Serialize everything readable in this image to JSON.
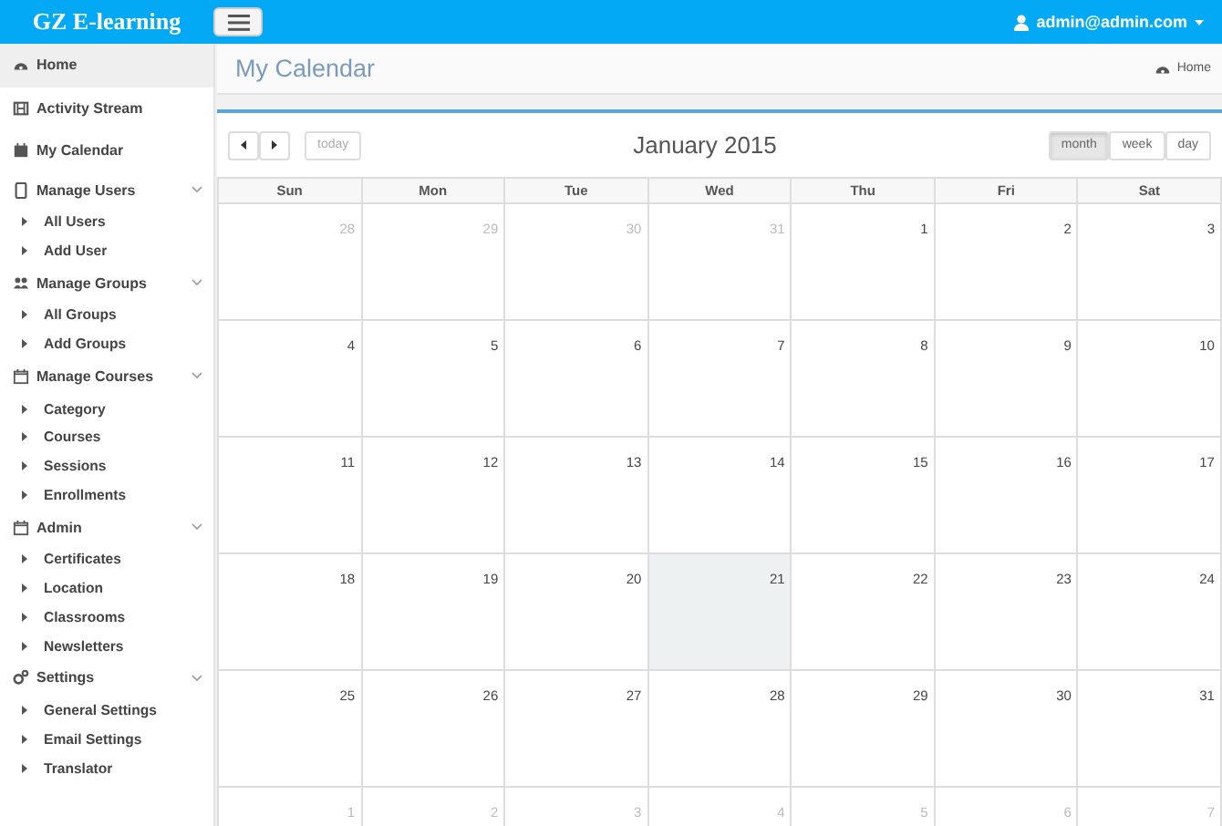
{
  "brand": "GZ E-learning",
  "user": "admin@admin.com",
  "sidebar": [
    {
      "label": "Home",
      "selected": true
    },
    {
      "label": "Activity Stream",
      "selected": false
    },
    {
      "label": "My Calendar",
      "selected": false
    },
    {
      "label": "Manage Users",
      "selected": false,
      "expanded": true,
      "children": [
        {
          "label": "All Users"
        },
        {
          "label": "Add User"
        }
      ]
    },
    {
      "label": "Manage Groups",
      "selected": false,
      "expanded": true,
      "children": [
        {
          "label": "All Groups"
        },
        {
          "label": "Add Groups"
        }
      ]
    },
    {
      "label": "Manage Courses",
      "selected": false,
      "expanded": true,
      "children": [
        {
          "label": "Category"
        },
        {
          "label": "Courses"
        },
        {
          "label": "Sessions"
        },
        {
          "label": "Enrollments"
        }
      ]
    },
    {
      "label": "Admin",
      "selected": false,
      "expanded": true,
      "children": [
        {
          "label": "Certificates"
        },
        {
          "label": "Location"
        },
        {
          "label": "Classrooms"
        },
        {
          "label": "Newsletters"
        }
      ]
    },
    {
      "label": "Settings",
      "selected": false,
      "expanded": true,
      "children": [
        {
          "label": "General Settings"
        },
        {
          "label": "Email Settings"
        },
        {
          "label": "Translator"
        }
      ]
    }
  ],
  "page_title": "My Calendar",
  "breadcrumb": "Home",
  "calendar": {
    "title": "January 2015",
    "today_button": "today",
    "views": [
      {
        "label": "month",
        "selected": true
      },
      {
        "label": "week",
        "selected": false
      },
      {
        "label": "day",
        "selected": false
      }
    ],
    "weekdays": [
      "Sun",
      "Mon",
      "Tue",
      "Wed",
      "Thu",
      "Fri",
      "Sat"
    ],
    "weeks": [
      [
        {
          "day": "28",
          "other_month": true
        },
        {
          "day": "29",
          "other_month": true
        },
        {
          "day": "30",
          "other_month": true
        },
        {
          "day": "31",
          "other_month": true
        },
        {
          "day": "1",
          "other_month": false
        },
        {
          "day": "2",
          "other_month": false
        },
        {
          "day": "3",
          "other_month": false
        }
      ],
      [
        {
          "day": "4",
          "other_month": false
        },
        {
          "day": "5",
          "other_month": false
        },
        {
          "day": "6",
          "other_month": false
        },
        {
          "day": "7",
          "other_month": false
        },
        {
          "day": "8",
          "other_month": false
        },
        {
          "day": "9",
          "other_month": false
        },
        {
          "day": "10",
          "other_month": false
        }
      ],
      [
        {
          "day": "11",
          "other_month": false
        },
        {
          "day": "12",
          "other_month": false
        },
        {
          "day": "13",
          "other_month": false
        },
        {
          "day": "14",
          "other_month": false
        },
        {
          "day": "15",
          "other_month": false
        },
        {
          "day": "16",
          "other_month": false
        },
        {
          "day": "17",
          "other_month": false
        }
      ],
      [
        {
          "day": "18",
          "other_month": false
        },
        {
          "day": "19",
          "other_month": false
        },
        {
          "day": "20",
          "other_month": false
        },
        {
          "day": "21",
          "other_month": false,
          "today": true
        },
        {
          "day": "22",
          "other_month": false
        },
        {
          "day": "23",
          "other_month": false
        },
        {
          "day": "24",
          "other_month": false
        }
      ],
      [
        {
          "day": "25",
          "other_month": false
        },
        {
          "day": "26",
          "other_month": false
        },
        {
          "day": "27",
          "other_month": false
        },
        {
          "day": "28",
          "other_month": false
        },
        {
          "day": "29",
          "other_month": false
        },
        {
          "day": "30",
          "other_month": false
        },
        {
          "day": "31",
          "other_month": false
        }
      ],
      [
        {
          "day": "1",
          "other_month": true
        },
        {
          "day": "2",
          "other_month": true
        },
        {
          "day": "3",
          "other_month": true
        },
        {
          "day": "4",
          "other_month": true
        },
        {
          "day": "5",
          "other_month": true
        },
        {
          "day": "6",
          "other_month": true
        },
        {
          "day": "7",
          "other_month": true
        }
      ]
    ]
  }
}
